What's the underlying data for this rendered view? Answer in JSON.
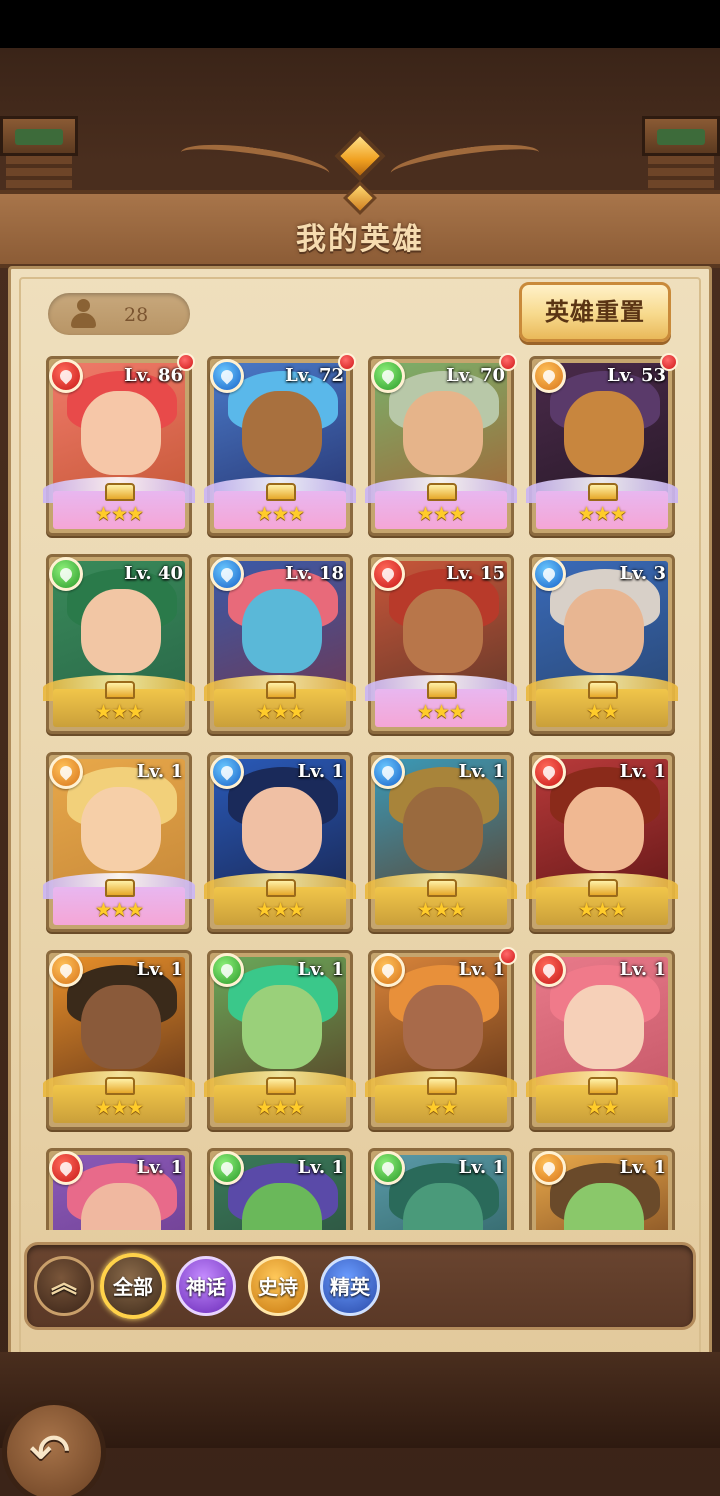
{
  "header": {
    "title": "我的英雄"
  },
  "hero_count": "28",
  "reset_button_label": "英雄重置",
  "heroes": [
    {
      "level": "Lv. 86",
      "stars": "★★★",
      "element": "fire",
      "rarity": "myth",
      "alert": true,
      "c1": "#f07a6a",
      "c2": "#c85a3a",
      "hair": "#e84a4a",
      "face": "#f6c7a8"
    },
    {
      "level": "Lv. 72",
      "stars": "★★★",
      "element": "water",
      "rarity": "myth",
      "alert": true,
      "c1": "#4a7ac8",
      "c2": "#2a3a78",
      "hair": "#5ab8ea",
      "face": "#a8703e"
    },
    {
      "level": "Lv. 70",
      "stars": "★★★",
      "element": "wind",
      "rarity": "myth",
      "alert": true,
      "c1": "#7ab06a",
      "c2": "#a06a3a",
      "hair": "#b8c8a8",
      "face": "#e6b48a"
    },
    {
      "level": "Lv. 53",
      "stars": "★★★",
      "element": "earth",
      "rarity": "myth",
      "alert": true,
      "c1": "#4a2a4a",
      "c2": "#2a1a2a",
      "hair": "#5a3a6a",
      "face": "#c8863e"
    },
    {
      "level": "Lv. 40",
      "stars": "★★★",
      "element": "wind",
      "rarity": "epic",
      "alert": false,
      "c1": "#3a8a5a",
      "c2": "#2a6a4a",
      "hair": "#2a7a4a",
      "face": "#f2c6a4"
    },
    {
      "level": "Lv. 18",
      "stars": "★★★",
      "element": "water",
      "rarity": "epic",
      "alert": false,
      "c1": "#3a5aa8",
      "c2": "#6a3a5a",
      "hair": "#e86a7a",
      "face": "#5ab8d8"
    },
    {
      "level": "Lv. 15",
      "stars": "★★★",
      "element": "fire",
      "rarity": "myth",
      "alert": false,
      "c1": "#c8563a",
      "c2": "#6a3a2a",
      "hair": "#b83a2a",
      "face": "#b8764a"
    },
    {
      "level": "Lv. 3",
      "stars": "★★",
      "element": "water",
      "rarity": "epic",
      "alert": false,
      "c1": "#3a6ab8",
      "c2": "#2a4a7a",
      "hair": "#d8d0c8",
      "face": "#e8b692"
    },
    {
      "level": "Lv. 1",
      "stars": "★★★",
      "element": "earth",
      "rarity": "myth",
      "alert": false,
      "c1": "#e8a84a",
      "c2": "#c88a3a",
      "hair": "#f2d07a",
      "face": "#f6cfa8"
    },
    {
      "level": "Lv. 1",
      "stars": "★★★",
      "element": "water",
      "rarity": "epic",
      "alert": false,
      "c1": "#2a5ab8",
      "c2": "#1a2a5a",
      "hair": "#1a2a5a",
      "face": "#f0c0a4"
    },
    {
      "level": "Lv. 1",
      "stars": "★★★",
      "element": "water",
      "rarity": "epic",
      "alert": false,
      "c1": "#3a9ab8",
      "c2": "#5a4a3a",
      "hair": "#a8843a",
      "face": "#9a6a3e"
    },
    {
      "level": "Lv. 1",
      "stars": "★★★",
      "element": "fire",
      "rarity": "epic",
      "alert": false,
      "c1": "#b83a3a",
      "c2": "#6a1a1a",
      "hair": "#8a2a1a",
      "face": "#f0b892"
    },
    {
      "level": "Lv. 1",
      "stars": "★★★",
      "element": "earth",
      "rarity": "epic",
      "alert": false,
      "c1": "#e8902a",
      "c2": "#6a3a1a",
      "hair": "#3a2a1a",
      "face": "#8a5a3a"
    },
    {
      "level": "Lv. 1",
      "stars": "★★★",
      "element": "wind",
      "rarity": "epic",
      "alert": false,
      "c1": "#6aa85a",
      "c2": "#5a4a2a",
      "hair": "#3ac88a",
      "face": "#9ad07a"
    },
    {
      "level": "Lv. 1",
      "stars": "★★",
      "element": "earth",
      "rarity": "epic",
      "alert": true,
      "c1": "#d8843a",
      "c2": "#6a3a1a",
      "hair": "#e8903a",
      "face": "#a86a4a"
    },
    {
      "level": "Lv. 1",
      "stars": "★★",
      "element": "fire",
      "rarity": "epic",
      "alert": false,
      "c1": "#e87a8a",
      "c2": "#c85a6a",
      "hair": "#f07a8a",
      "face": "#f6d0b8"
    },
    {
      "level": "Lv. 1",
      "stars": "",
      "element": "fire",
      "rarity": "epic",
      "alert": false,
      "c1": "#8a5ab8",
      "c2": "#6a3a8a",
      "hair": "#e86a8a",
      "face": "#f0b8a0"
    },
    {
      "level": "Lv. 1",
      "stars": "",
      "element": "wind",
      "rarity": "epic",
      "alert": false,
      "c1": "#3a7a5a",
      "c2": "#2a4a3a",
      "hair": "#5a4aa8",
      "face": "#6ab85a"
    },
    {
      "level": "Lv. 1",
      "stars": "",
      "element": "wind",
      "rarity": "epic",
      "alert": false,
      "c1": "#5a9aa8",
      "c2": "#2a5a5a",
      "hair": "#2a6a5a",
      "face": "#4a9a7a"
    },
    {
      "level": "Lv. 1",
      "stars": "",
      "element": "earth",
      "rarity": "epic",
      "alert": false,
      "c1": "#e8a84a",
      "c2": "#6a3a1a",
      "hair": "#6a4a2a",
      "face": "#8ac86a"
    }
  ],
  "filters": {
    "collapse_icon": "chevron-up-icon",
    "all": "全部",
    "myth": "神话",
    "epic": "史诗",
    "elite": "精英"
  },
  "back_icon": "back-arrow-icon"
}
